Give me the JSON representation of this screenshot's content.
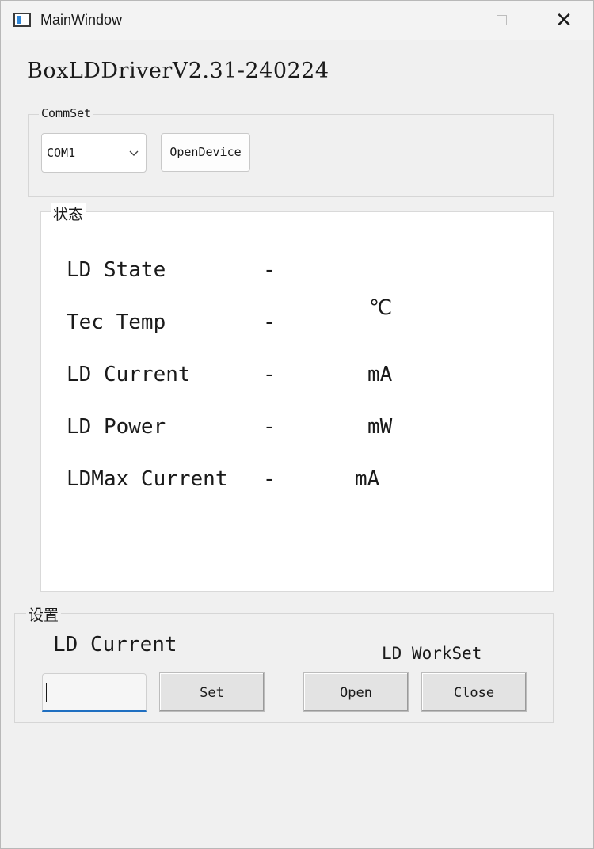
{
  "window": {
    "title": "MainWindow",
    "close_glyph": "✕"
  },
  "app": {
    "title": "BoxLDDriverV2.31-240224"
  },
  "commset": {
    "group_label": "CommSet",
    "port_value": "COM1",
    "open_device_label": "OpenDevice"
  },
  "status": {
    "group_label": "状态",
    "rows": [
      {
        "label": "LD State",
        "value": "-",
        "unit": ""
      },
      {
        "label": "Tec Temp",
        "value": "-",
        "unit": "℃"
      },
      {
        "label": "LD Current",
        "value": "-",
        "unit": "mA"
      },
      {
        "label": "LD Power",
        "value": "-",
        "unit": "mW"
      },
      {
        "label": "LDMax Current",
        "value": "-",
        "unit": "mA"
      }
    ]
  },
  "settings": {
    "group_label": "设置",
    "ld_current_label": "LD Current",
    "ld_current_value": "",
    "set_label": "Set",
    "workset_label": "LD WorkSet",
    "open_label": "Open",
    "close_label": "Close"
  },
  "icons": {
    "app": "window-app-icon",
    "minimize": "minimize-icon",
    "maximize": "maximize-icon",
    "close": "close-icon",
    "dropdown": "chevron-down-icon"
  },
  "colors": {
    "accent": "#1f6fc1",
    "window_bg": "#f0f0f0",
    "panel_bg": "#ffffff"
  }
}
